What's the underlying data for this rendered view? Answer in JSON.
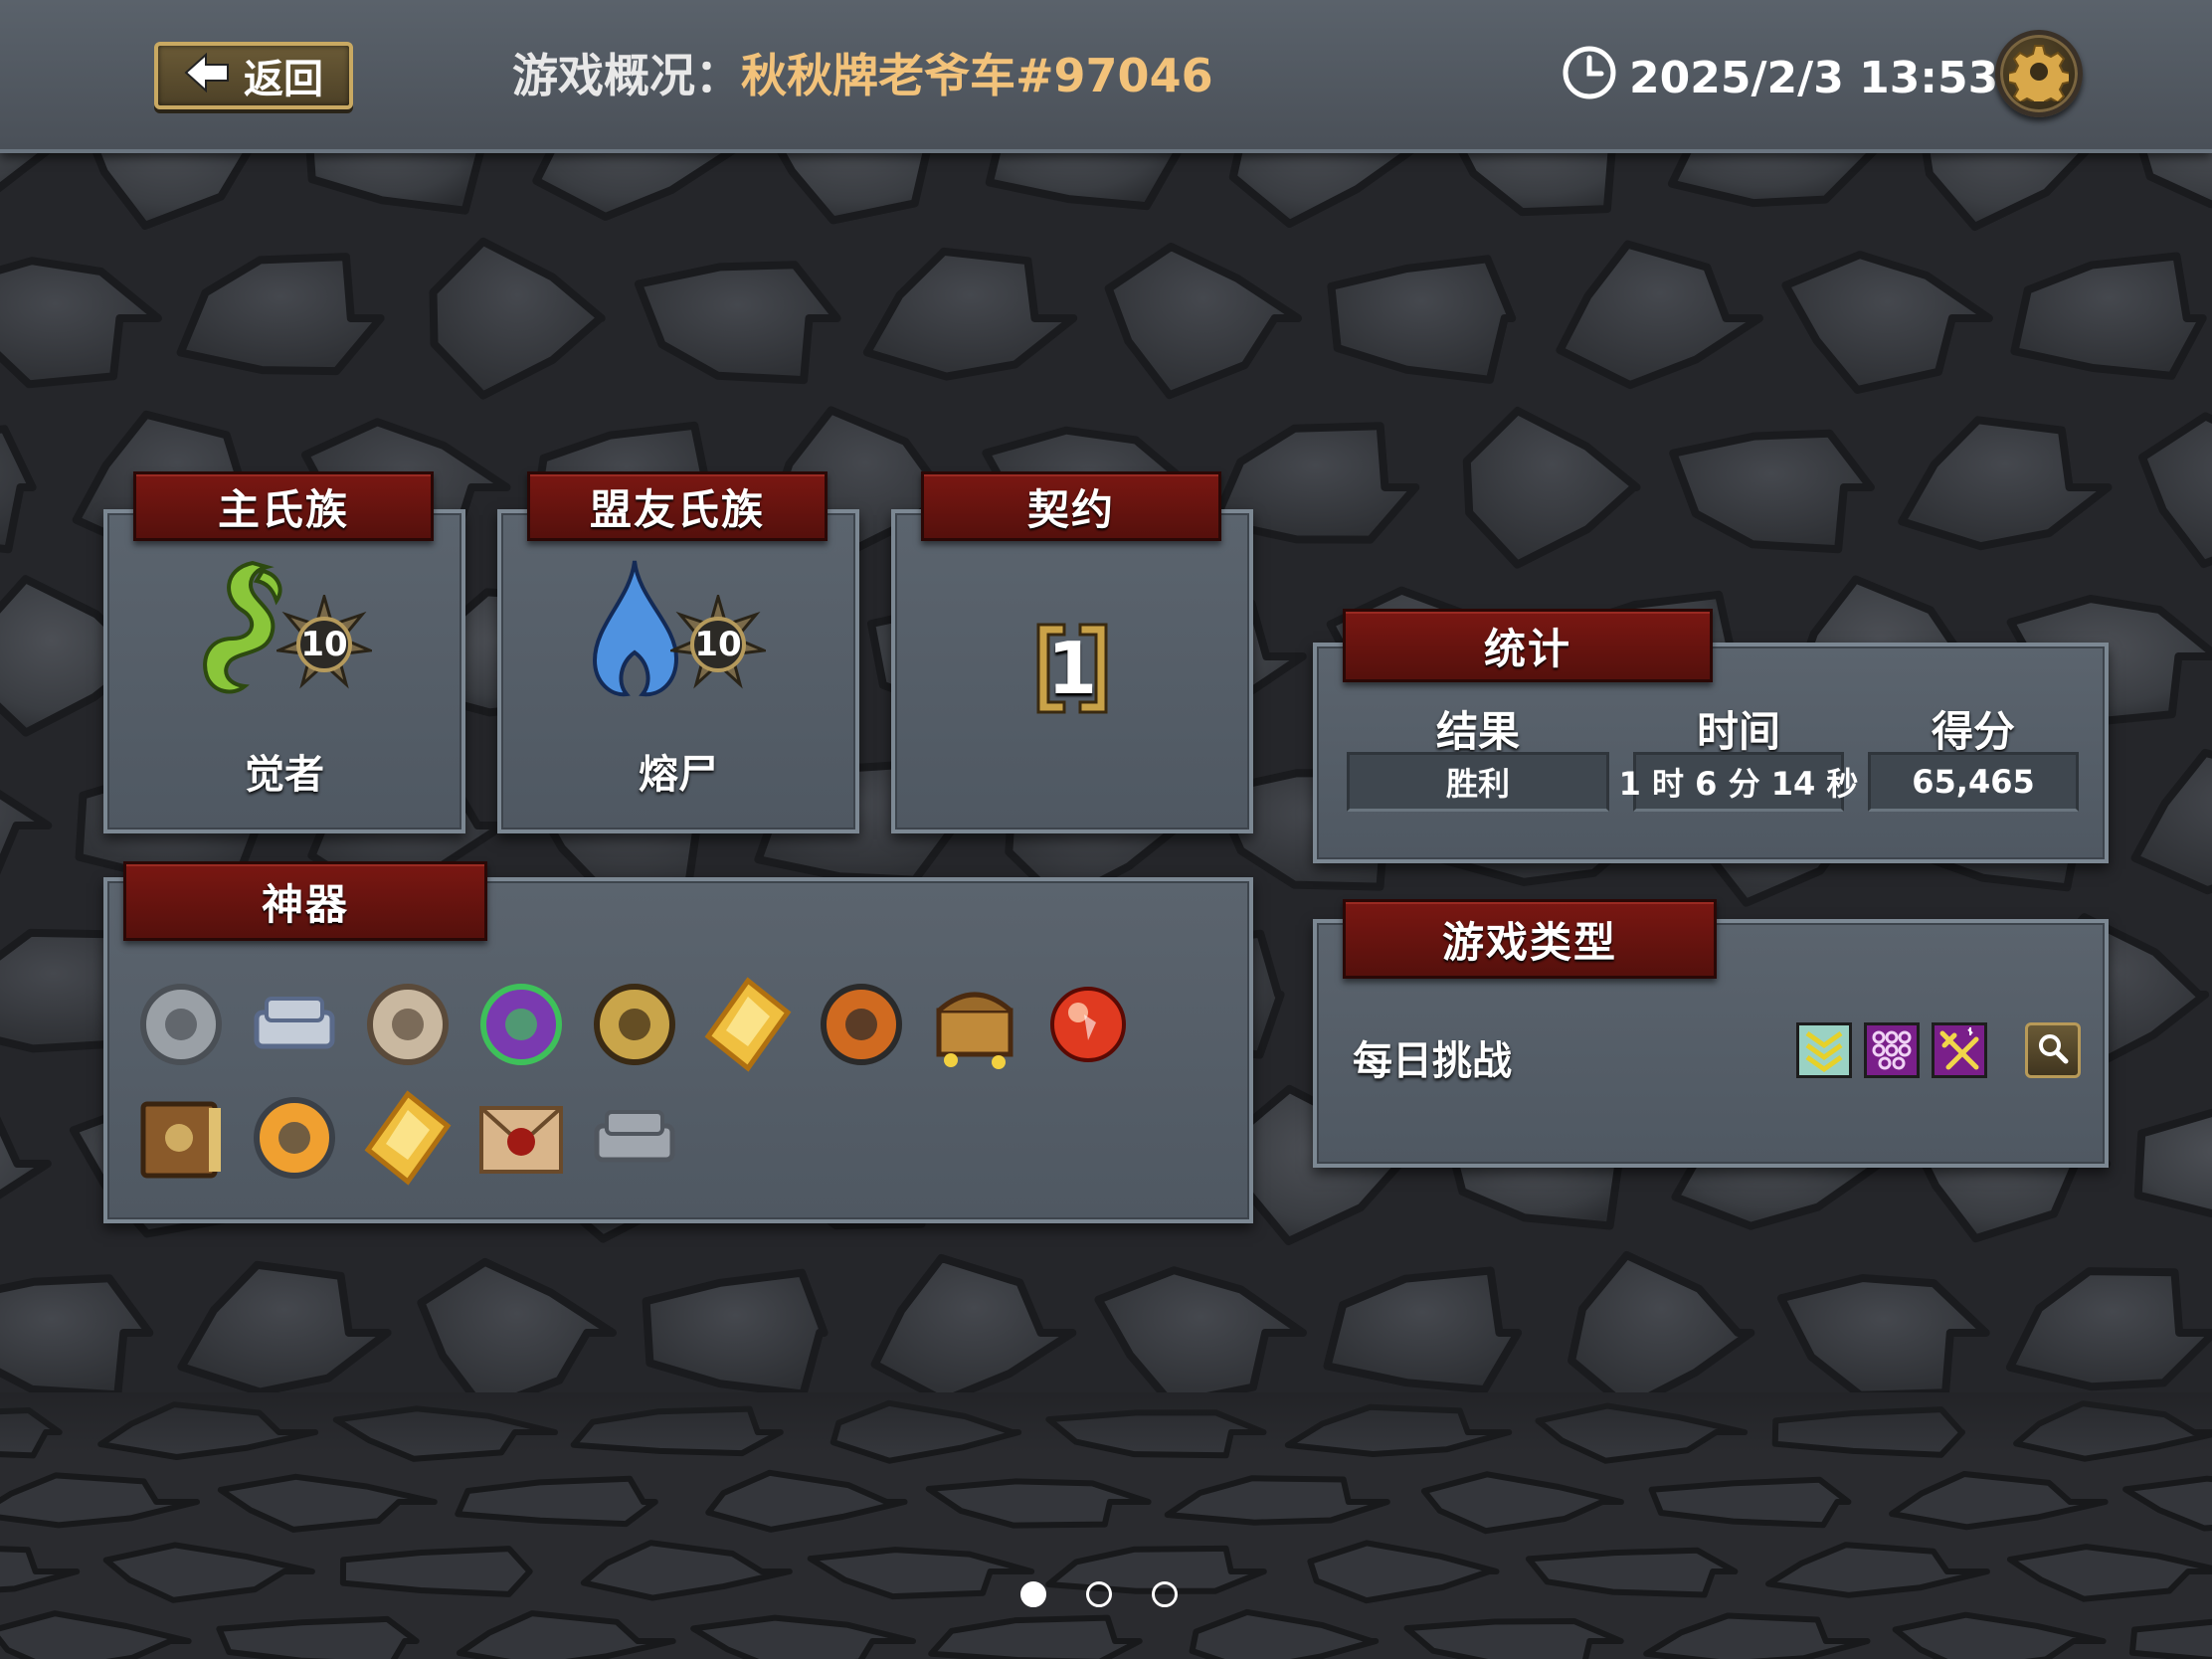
{
  "header": {
    "back_label": "返回",
    "title_label": "游戏概况：",
    "title_name": "秋秋牌老爷车#97046",
    "datetime": "2025/2/3 13:53"
  },
  "icons": {
    "back": "arrow-left-icon",
    "clock": "clock-icon",
    "settings": "gear-icon",
    "search": "magnifier-icon"
  },
  "main_clan": {
    "title": "主氏族",
    "name": "觉者",
    "level": "10",
    "emblem": "green-tendril-icon"
  },
  "ally_clan": {
    "title": "盟友氏族",
    "name": "熔尸",
    "level": "10",
    "emblem": "blue-flame-icon"
  },
  "pact": {
    "title": "契约",
    "value": "1"
  },
  "stats": {
    "title": "统计",
    "headers": [
      "结果",
      "时间",
      "得分"
    ],
    "values": [
      "胜利",
      "1 时 6 分 14 秒",
      "65,465"
    ]
  },
  "artifacts": {
    "title": "神器",
    "items": [
      "armor-breastplate-icon",
      "silver-ingots-icon",
      "grindstone-icon",
      "purple-cloth-icon",
      "compass-ring-icon",
      "gold-crystal-icon",
      "axe-lantern-icon",
      "treasure-chest-icon",
      "red-orb-icon",
      "ancient-tome-icon",
      "brazier-icon",
      "gold-crystal-icon",
      "sealed-letter-icon",
      "steel-bars-icon"
    ]
  },
  "game_type": {
    "title": "游戏类型",
    "label": "每日挑战",
    "modifiers": [
      "chevrons-down-icon",
      "dots-grid-icon",
      "crossed-swords-icon"
    ]
  },
  "pager": {
    "pages": 3,
    "active": 0
  },
  "colors": {
    "ribbon_red": "#6b1410",
    "title_gold": "#f2c27a",
    "panel_steel": "#56606a",
    "button_gold": "#c9a962"
  }
}
